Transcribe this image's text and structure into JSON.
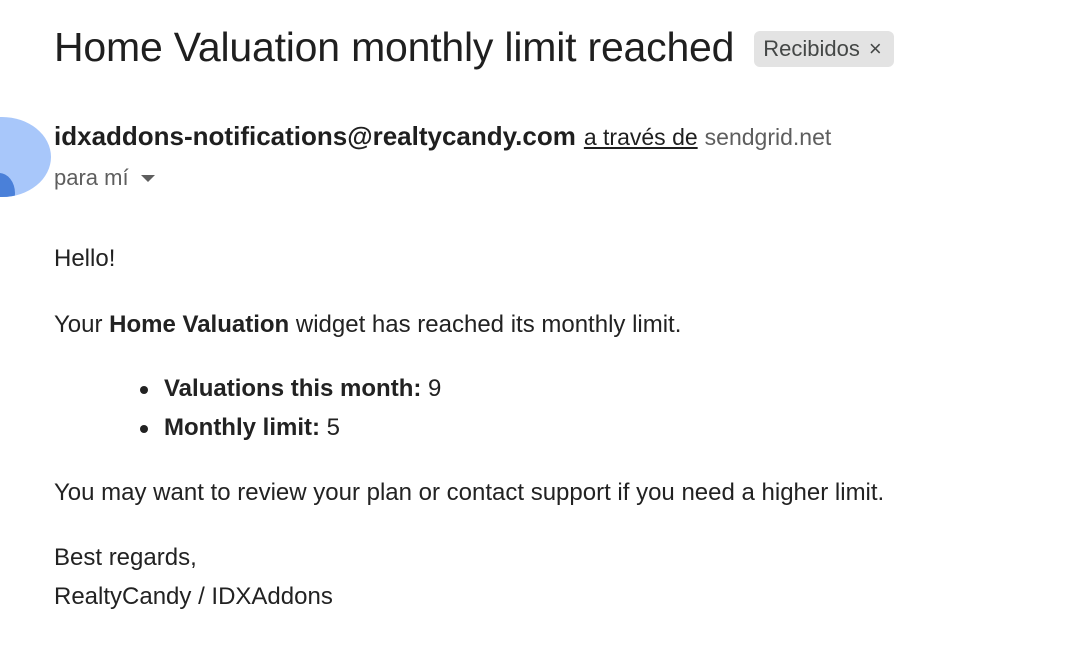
{
  "email": {
    "subject": "Home Valuation monthly limit reached",
    "label": "Recibidos",
    "label_remove_glyph": "×",
    "sender_email": "idxaddons-notifications@realtycandy.com",
    "via_text": "a través de",
    "via_domain": "sendgrid.net",
    "recipient_text": "para mí",
    "avatar_color": "#a8c7fa"
  },
  "body": {
    "greeting": "Hello!",
    "widget_prefix": "Your ",
    "widget_name": "Home Valuation",
    "widget_suffix": " widget has reached its monthly limit.",
    "stats": [
      {
        "label": "Valuations this month:",
        "value": "9"
      },
      {
        "label": "Monthly limit:",
        "value": "5"
      }
    ],
    "review_text": "You may want to review your plan or contact support if you need a higher limit.",
    "closing": "Best regards,",
    "signature": "RealtyCandy / IDXAddons"
  }
}
